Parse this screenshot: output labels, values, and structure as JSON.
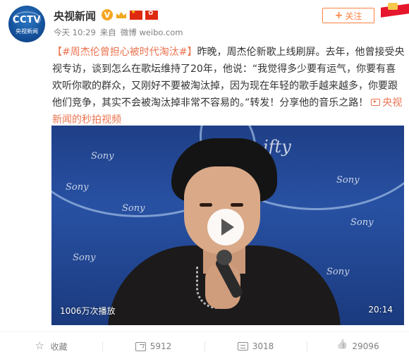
{
  "account": {
    "name": "央视新闻",
    "avatar_logo": "CCTV",
    "avatar_sub": "央视新闻",
    "badges": [
      "verified-v-icon",
      "crown-icon",
      "china-flag-icon",
      "hongkong-flag-icon"
    ],
    "verified_symbol": "V"
  },
  "meta": {
    "time": "今天 10:29",
    "source_prefix": "来自",
    "source": "微博 weibo.com"
  },
  "follow": {
    "plus": "+",
    "label": "关注",
    "color": "#ff8140"
  },
  "post": {
    "hashtag": "【#周杰伦曾担心被时代淘汰#】",
    "body": "昨晚，周杰伦新歌上线刷屏。去年，他曾接受央视专访，谈到怎么在歌坛维持了20年，他说：“我觉得多少要有运气，你要有喜欢听你歌的群众，又刚好不要被淘汰掉，因为现在年轻的歌手越来越多，你要跟他们竞争，其实不会被淘汰掉非常不容易的。”转发！分享他的音乐之路！",
    "link_text": "央视新闻的秒拍视频",
    "accent": "#eb7350"
  },
  "video": {
    "play_count": "1006万次播放",
    "duration": "20:14",
    "wall_texts": [
      "Sony",
      "ifty",
      "Sony",
      "Sony",
      "Sony",
      "Sony",
      "Sony",
      "Sony"
    ]
  },
  "actions": [
    {
      "name": "favorite",
      "icon": "star-icon",
      "label": "收藏"
    },
    {
      "name": "share",
      "icon": "share-icon",
      "label": "5912"
    },
    {
      "name": "comment",
      "icon": "comment-icon",
      "label": "3018"
    },
    {
      "name": "like",
      "icon": "thumbs-up-icon",
      "label": "29096"
    }
  ]
}
